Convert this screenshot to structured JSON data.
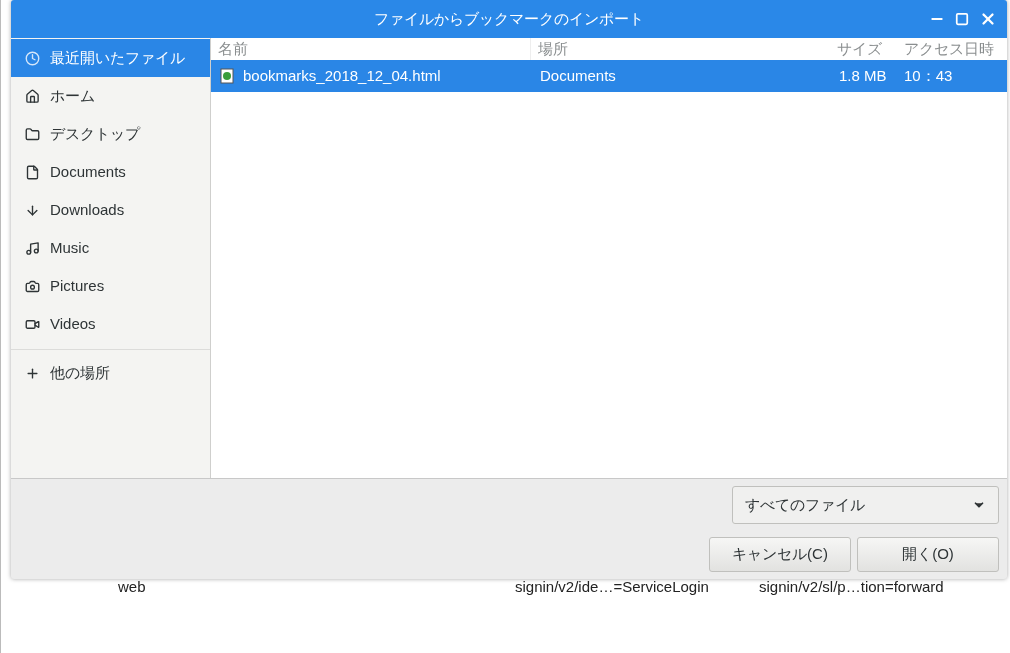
{
  "window": {
    "title": "ファイルからブックマークのインポート"
  },
  "sidebar": {
    "items": [
      {
        "kind": "recent",
        "label": "最近開いたファイル",
        "selected": true
      },
      {
        "kind": "home",
        "label": "ホーム",
        "selected": false
      },
      {
        "kind": "desktop",
        "label": "デスクトップ",
        "selected": false
      },
      {
        "kind": "documents",
        "label": "Documents",
        "selected": false
      },
      {
        "kind": "downloads",
        "label": "Downloads",
        "selected": false
      },
      {
        "kind": "music",
        "label": "Music",
        "selected": false
      },
      {
        "kind": "pictures",
        "label": "Pictures",
        "selected": false
      },
      {
        "kind": "videos",
        "label": "Videos",
        "selected": false
      },
      {
        "kind": "other",
        "label": "他の場所",
        "selected": false
      }
    ]
  },
  "table": {
    "columns": [
      "名前",
      "場所",
      "サイズ",
      "アクセス日時"
    ],
    "rows": [
      {
        "name": "bookmarks_2018_12_04.html",
        "location": "Documents",
        "size": "1.8 MB",
        "time": "10：43",
        "selected": true
      }
    ]
  },
  "filter": {
    "value": "すべてのファイル"
  },
  "buttons": [
    "キャンセル(C)",
    "開く(O)"
  ],
  "background_row": [
    "web",
    "signin/v2/ide…=ServiceLogin",
    "signin/v2/sl/p…tion=forward"
  ]
}
